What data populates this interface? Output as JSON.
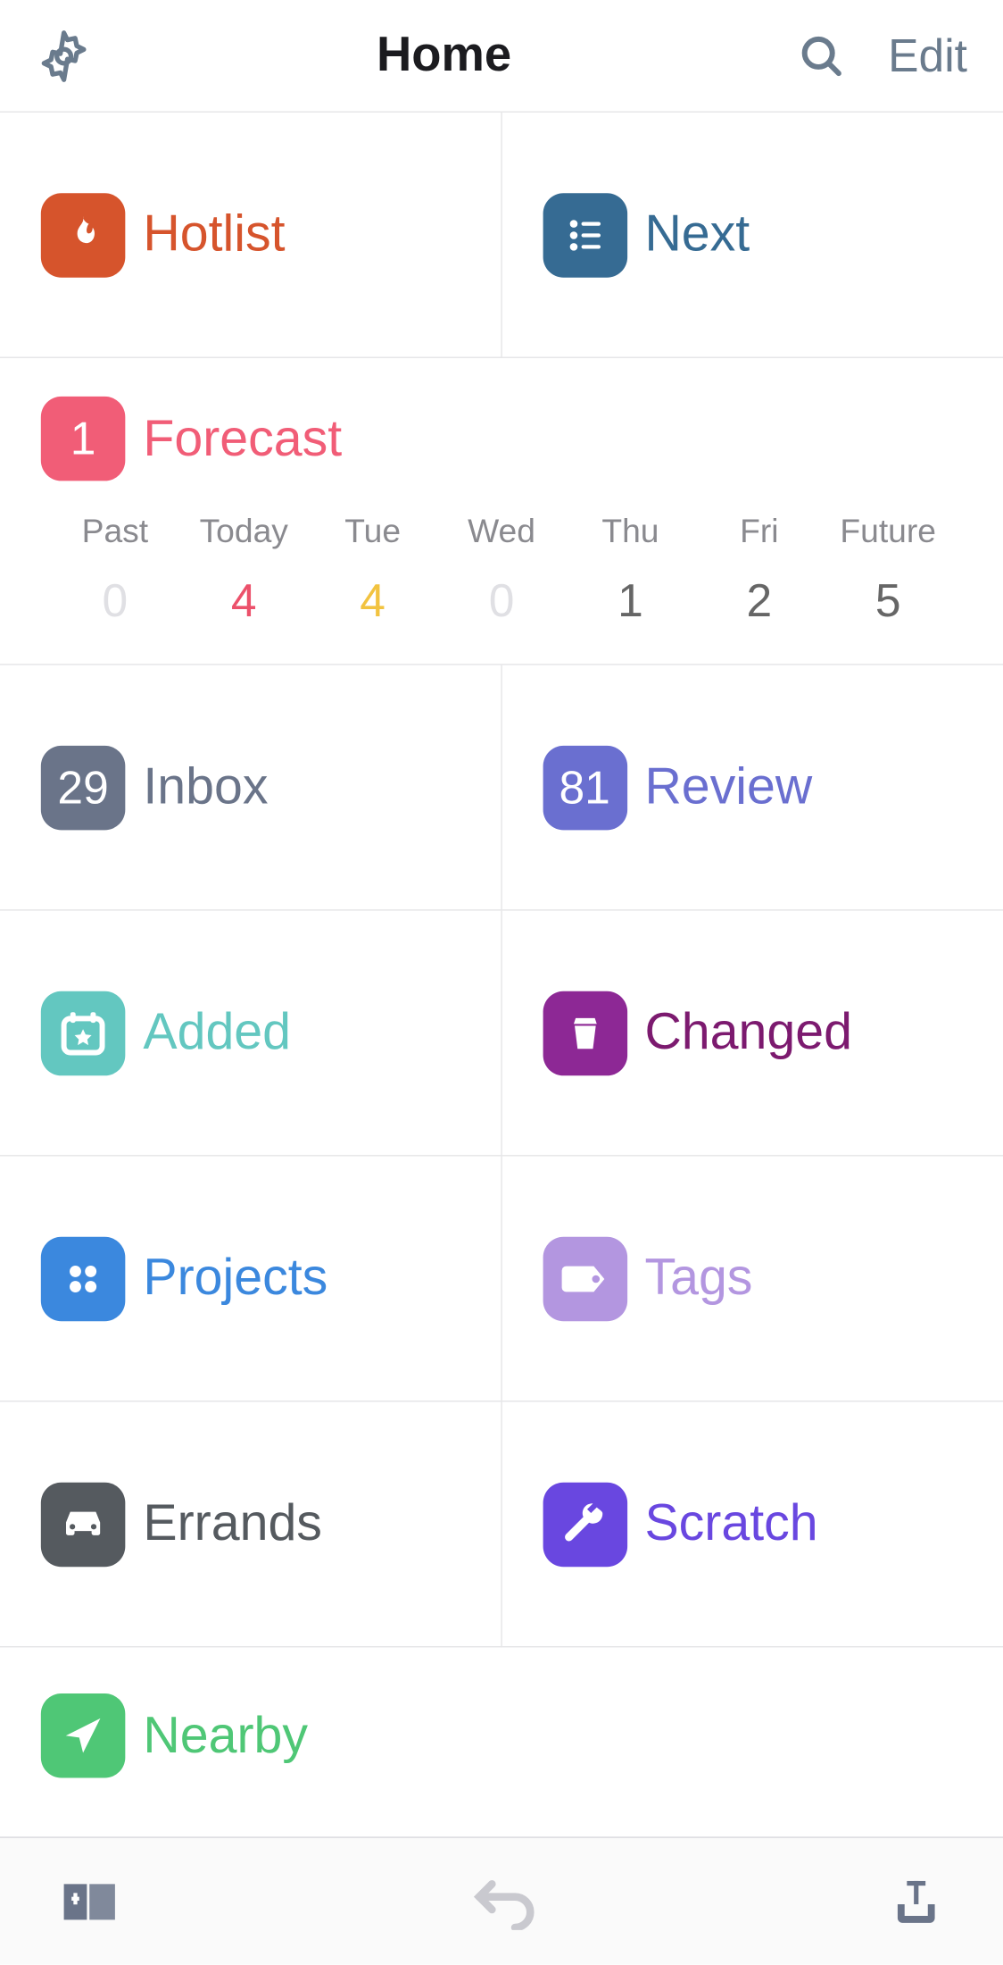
{
  "header": {
    "title": "Home",
    "edit_label": "Edit"
  },
  "tiles": {
    "hotlist": {
      "label": "Hotlist"
    },
    "next": {
      "label": "Next"
    },
    "forecast": {
      "label": "Forecast",
      "badge": "1"
    },
    "inbox": {
      "label": "Inbox",
      "badge": "29"
    },
    "review": {
      "label": "Review",
      "badge": "81"
    },
    "added": {
      "label": "Added"
    },
    "changed": {
      "label": "Changed"
    },
    "projects": {
      "label": "Projects"
    },
    "tags": {
      "label": "Tags"
    },
    "errands": {
      "label": "Errands"
    },
    "scratch": {
      "label": "Scratch"
    },
    "nearby": {
      "label": "Nearby"
    }
  },
  "forecast": {
    "days": [
      {
        "name": "Past",
        "count": "0",
        "cls": "zero"
      },
      {
        "name": "Today",
        "count": "4",
        "cls": "c-red"
      },
      {
        "name": "Tue",
        "count": "4",
        "cls": "c-yellow"
      },
      {
        "name": "Wed",
        "count": "0",
        "cls": "zero"
      },
      {
        "name": "Thu",
        "count": "1",
        "cls": "c-gray"
      },
      {
        "name": "Fri",
        "count": "2",
        "cls": "c-gray"
      },
      {
        "name": "Future",
        "count": "5",
        "cls": "c-gray"
      }
    ]
  },
  "colors": {
    "hotlist": "#d6542c",
    "next": "#366b93",
    "forecast": "#f15d77",
    "inbox": "#6a7489",
    "review": "#6a6fd0",
    "added": "#63c7c0",
    "changed": "#8d2895",
    "projects": "#3b88de",
    "tags": "#b396e0",
    "errands": "#555a5f",
    "scratch": "#6947e0",
    "nearby": "#4fc776"
  },
  "icons": {
    "settings": "gear-icon",
    "search": "search-icon",
    "hotlist": "flame-icon",
    "next": "list-icon",
    "added": "calendar-star-icon",
    "changed": "cup-icon",
    "projects": "dots-icon",
    "tags": "tag-icon",
    "errands": "car-icon",
    "scratch": "wrench-icon",
    "nearby": "location-arrow-icon",
    "toolbar_left": "add-panel-icon",
    "toolbar_mid": "undo-icon",
    "toolbar_right": "export-icon"
  }
}
